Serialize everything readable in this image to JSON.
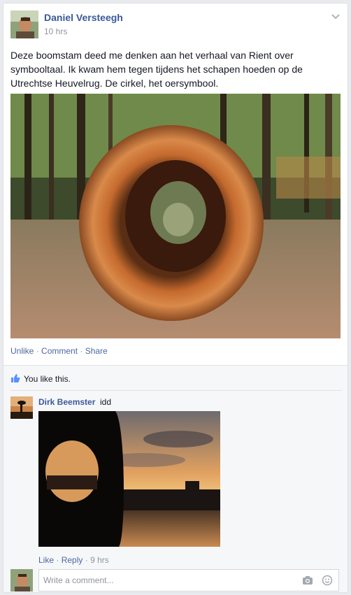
{
  "post": {
    "author": "Daniel Versteegh",
    "time": "10 hrs",
    "text": "Deze boomstam deed me denken aan het verhaal van Rient over symbooltaal. Ik kwam hem tegen tijdens het schapen hoeden op de Utrechtse Heuvelrug. De cirkel, het oersymbool.",
    "actions": {
      "unlike": "Unlike",
      "comment": "Comment",
      "share": "Share",
      "sep": "·"
    }
  },
  "likes": {
    "text": "You like this."
  },
  "comment": {
    "author": "Dirk Beemster",
    "text": "idd",
    "actions": {
      "like": "Like",
      "reply": "Reply",
      "time": "9 hrs",
      "sep": "·"
    }
  },
  "composer": {
    "placeholder": "Write a comment..."
  },
  "icons": {
    "chevron": "chevron-down-icon",
    "thumb": "thumbs-up-icon",
    "camera": "camera-icon",
    "emoji": "smiley-icon"
  },
  "colors": {
    "link": "#3b5998",
    "action": "#4b67a1",
    "muted": "#90949c",
    "feedback_bg": "#f6f7f9"
  }
}
